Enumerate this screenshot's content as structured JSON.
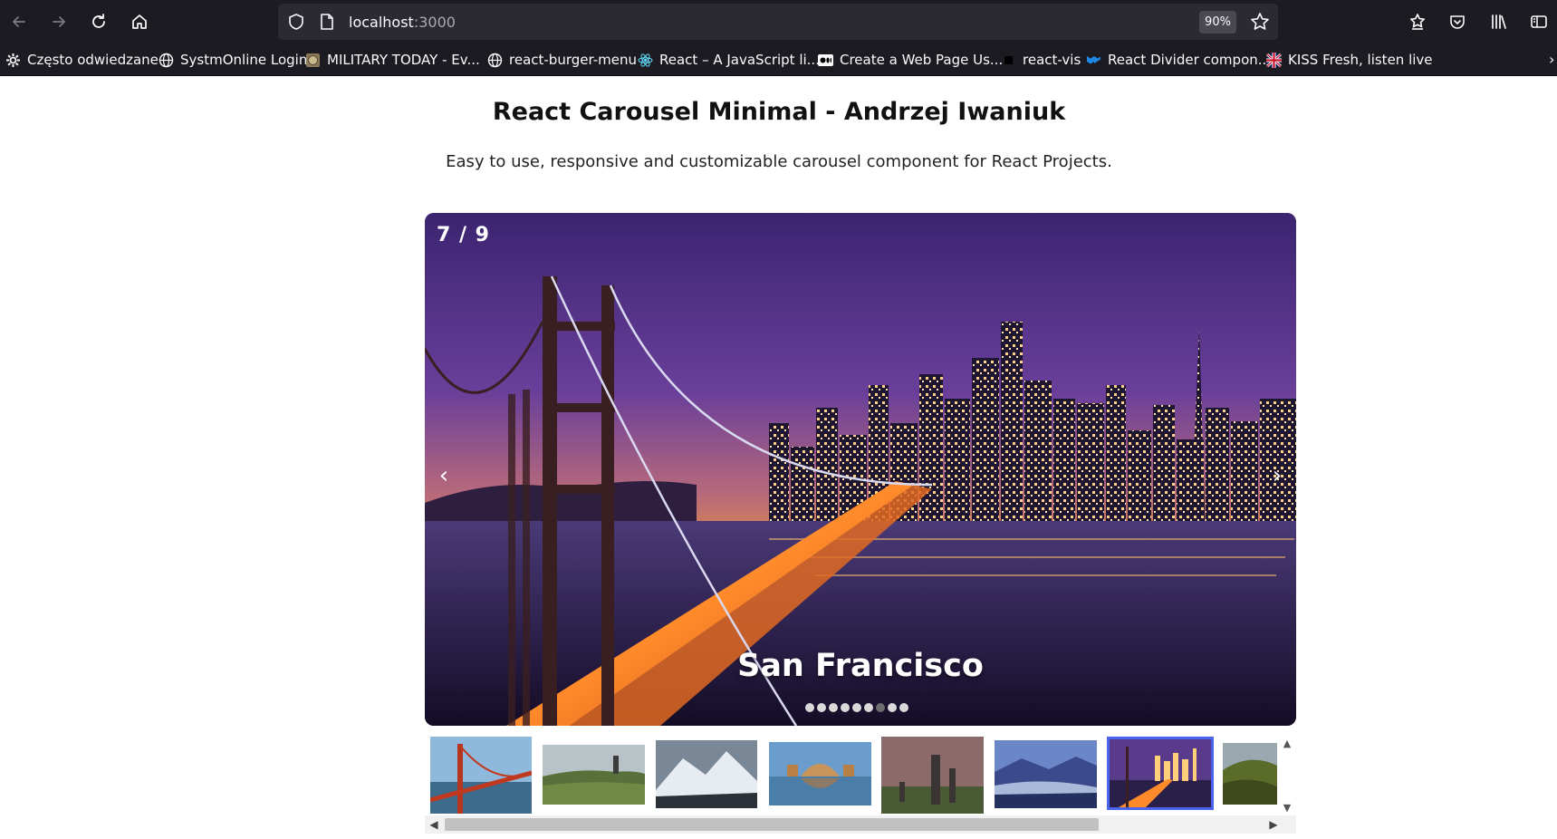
{
  "browser": {
    "url_host": "localhost",
    "url_port": ":3000",
    "zoom": "90%"
  },
  "bookmarks": [
    {
      "label": "Często odwiedzane",
      "icon": "gear-icon"
    },
    {
      "label": "SystmOnline Login",
      "icon": "globe-icon"
    },
    {
      "label": "MILITARY TODAY - Ev...",
      "icon": "military-icon"
    },
    {
      "label": "react-burger-menu",
      "icon": "globe-icon"
    },
    {
      "label": "React – A JavaScript li...",
      "icon": "react-icon"
    },
    {
      "label": "Create a Web Page Us...",
      "icon": "medium-icon"
    },
    {
      "label": "react-vis",
      "icon": "square-icon"
    },
    {
      "label": "React Divider compon...",
      "icon": "mui-icon"
    },
    {
      "label": "KISS Fresh, listen live",
      "icon": "uk-flag-icon"
    }
  ],
  "page": {
    "title": "React Carousel Minimal - Andrzej Iwaniuk",
    "subtitle": "Easy to use, responsive and customizable carousel component for React Projects."
  },
  "carousel": {
    "slide_number": "7 / 9",
    "caption": "San Francisco",
    "current_index": 7,
    "total": 9,
    "prev_glyph": "‹",
    "next_glyph": "›"
  },
  "thumbnails": [
    {
      "icon": "golden-gate-thumbnail"
    },
    {
      "icon": "scotland-hills-thumbnail"
    },
    {
      "icon": "snowy-mountain-thumbnail"
    },
    {
      "icon": "palace-reflection-thumbnail"
    },
    {
      "icon": "standing-stones-thumbnail"
    },
    {
      "icon": "misty-mountains-thumbnail"
    },
    {
      "icon": "san-francisco-thumbnail"
    },
    {
      "icon": "green-hills-thumbnail"
    }
  ],
  "colors": {
    "browser_bg": "#1c1b22",
    "urlbar_bg": "#2b2a33",
    "active_thumb_border": "#4a64f0"
  }
}
